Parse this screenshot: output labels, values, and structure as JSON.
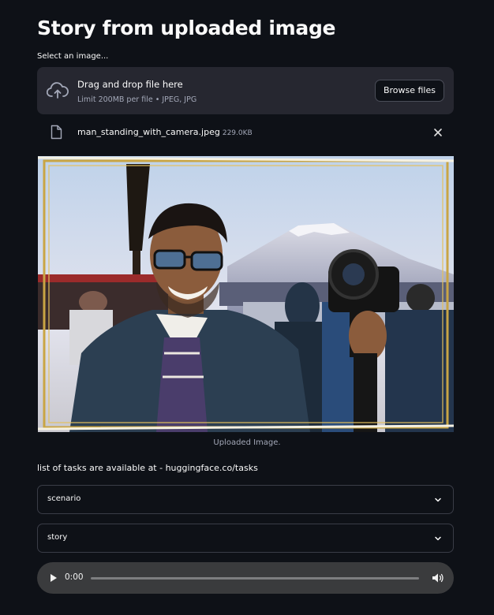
{
  "page": {
    "title": "Story from uploaded image"
  },
  "uploader": {
    "label": "Select an image...",
    "drop_title": "Drag and drop file here",
    "drop_subtitle": "Limit 200MB per file • JPEG, JPG",
    "browse_label": "Browse files"
  },
  "file": {
    "name": "man_standing_with_camera.jpeg",
    "size": "229.0KB"
  },
  "image": {
    "caption": "Uploaded Image."
  },
  "tasks": {
    "text": "list of tasks are available at - huggingface.co/tasks"
  },
  "expanders": [
    {
      "label": "scenario"
    },
    {
      "label": "story"
    }
  ],
  "audio": {
    "time": "0:00",
    "progress": 0
  },
  "icons": [
    "cloud-upload-icon",
    "file-icon",
    "close-icon",
    "chevron-down-icon",
    "play-icon",
    "volume-icon"
  ],
  "colors": {
    "background": "#0e1117",
    "panel": "#262730",
    "audio_bar": "#3a3b3d"
  }
}
